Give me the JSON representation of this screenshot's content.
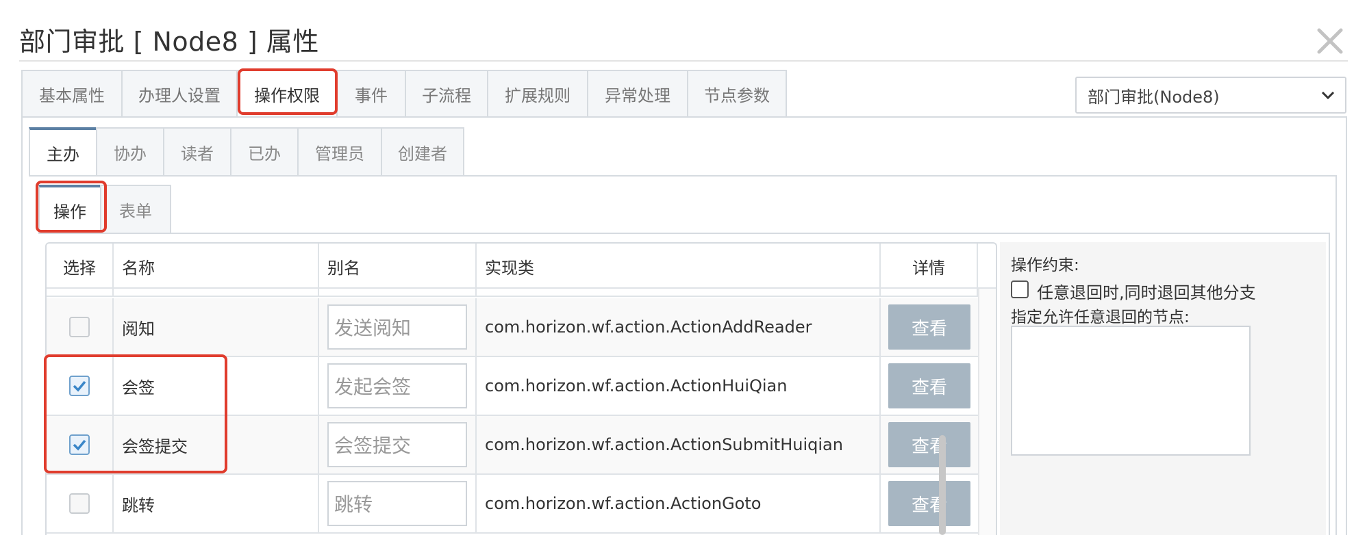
{
  "dialog": {
    "title": "部门审批 [ Node8 ] 属性",
    "close_icon": "close-icon"
  },
  "outer_tabs": [
    {
      "label": "基本属性",
      "active": false
    },
    {
      "label": "办理人设置",
      "active": false
    },
    {
      "label": "操作权限",
      "active": true
    },
    {
      "label": "事件",
      "active": false
    },
    {
      "label": "子流程",
      "active": false
    },
    {
      "label": "扩展规则",
      "active": false
    },
    {
      "label": "异常处理",
      "active": false
    },
    {
      "label": "节点参数",
      "active": false
    }
  ],
  "node_select": {
    "value": "部门审批(Node8)"
  },
  "inner_tabs": [
    {
      "label": "主办",
      "active": true
    },
    {
      "label": "协办",
      "active": false
    },
    {
      "label": "读者",
      "active": false
    },
    {
      "label": "已办",
      "active": false
    },
    {
      "label": "管理员",
      "active": false
    },
    {
      "label": "创建者",
      "active": false
    }
  ],
  "sub_tabs": [
    {
      "label": "操作",
      "active": true
    },
    {
      "label": "表单",
      "active": false
    }
  ],
  "table": {
    "headers": {
      "select": "选择",
      "name": "名称",
      "alias": "别名",
      "impl": "实现类",
      "detail": "详情"
    },
    "rows": [
      {
        "checked": false,
        "name": "阅知",
        "alias": "发送阅知",
        "impl": "com.horizon.wf.action.ActionAddReader",
        "button": "查看"
      },
      {
        "checked": true,
        "name": "会签",
        "alias": "发起会签",
        "impl": "com.horizon.wf.action.ActionHuiQian",
        "button": "查看"
      },
      {
        "checked": true,
        "name": "会签提交",
        "alias": "会签提交",
        "impl": "com.horizon.wf.action.ActionSubmitHuiqian",
        "button": "查看"
      },
      {
        "checked": false,
        "name": "跳转",
        "alias": "跳转",
        "impl": "com.horizon.wf.action.ActionGoto",
        "button": "查看"
      }
    ]
  },
  "constraints": {
    "title": "操作约束:",
    "checkbox_label": "任意退回时,同时退回其他分支",
    "nodes_label": "指定允许任意退回的节点:"
  },
  "colors": {
    "highlight": "#e03c2d",
    "button_bg": "#a7b6c2",
    "active_tab_accent": "#5b7fa3",
    "check_blue": "#3a86c8"
  }
}
